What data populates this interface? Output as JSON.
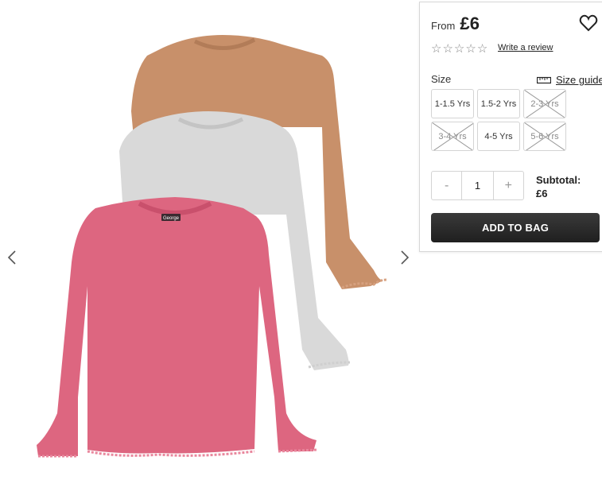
{
  "product": {
    "price_from": "From",
    "price": "£6",
    "review_link": "Write a review",
    "rating_stars": 0,
    "rating_max": 5,
    "tag_label": "George"
  },
  "sizes": {
    "label": "Size",
    "guide_label": "Size guide",
    "options": [
      {
        "label": "1-1.5 Yrs",
        "available": true
      },
      {
        "label": "1.5-2 Yrs",
        "available": true
      },
      {
        "label": "2-3 Yrs",
        "available": false
      },
      {
        "label": "3-4 Yrs",
        "available": false
      },
      {
        "label": "4-5 Yrs",
        "available": true
      },
      {
        "label": "5-6 Yrs",
        "available": false
      }
    ]
  },
  "quantity": {
    "minus": "-",
    "value": "1",
    "plus": "+"
  },
  "subtotal": {
    "label": "Subtotal:",
    "amount": "£6"
  },
  "cta": {
    "add_to_bag": "ADD TO BAG"
  },
  "icons": {
    "wishlist": "heart-icon",
    "size_guide": "ruler-icon",
    "prev": "chevron-left-icon",
    "next": "chevron-right-icon"
  },
  "colors": {
    "shirt_tan": "#c8906a",
    "shirt_grey": "#d9d9d9",
    "shirt_pink": "#dd6680",
    "button_dark": "#262626"
  }
}
